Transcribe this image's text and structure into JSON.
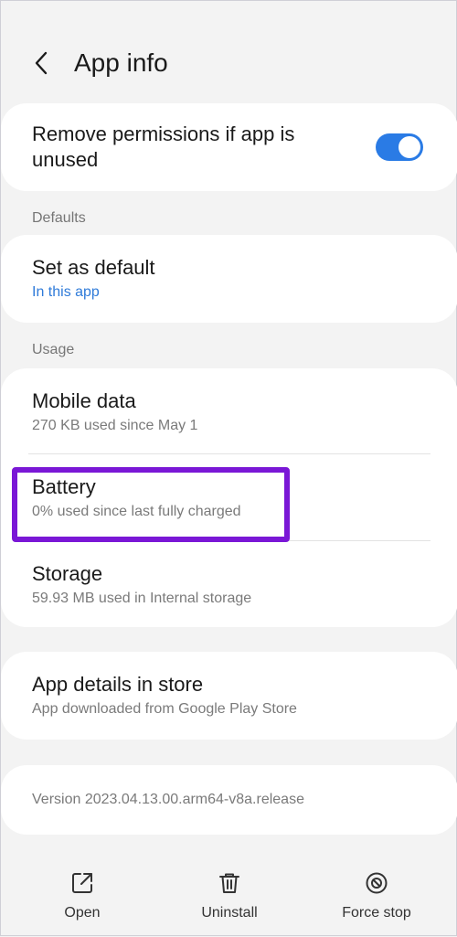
{
  "header": {
    "title": "App info"
  },
  "permissions": {
    "title": "Remove permissions if app is unused",
    "toggle_on": true
  },
  "defaults": {
    "section_label": "Defaults",
    "set_default": {
      "title": "Set as default",
      "subtitle": "In this app"
    }
  },
  "usage": {
    "section_label": "Usage",
    "mobile_data": {
      "title": "Mobile data",
      "subtitle": "270 KB used since May 1"
    },
    "battery": {
      "title": "Battery",
      "subtitle": "0% used since last fully charged"
    },
    "storage": {
      "title": "Storage",
      "subtitle": "59.93 MB used in Internal storage"
    }
  },
  "store": {
    "title": "App details in store",
    "subtitle": "App downloaded from Google Play Store"
  },
  "version": {
    "text": "Version 2023.04.13.00.arm64-v8a.release"
  },
  "bottom_bar": {
    "open": "Open",
    "uninstall": "Uninstall",
    "force_stop": "Force stop"
  },
  "colors": {
    "accent": "#2a7be5",
    "highlight": "#7a17d6",
    "background": "#f3f3f3"
  }
}
